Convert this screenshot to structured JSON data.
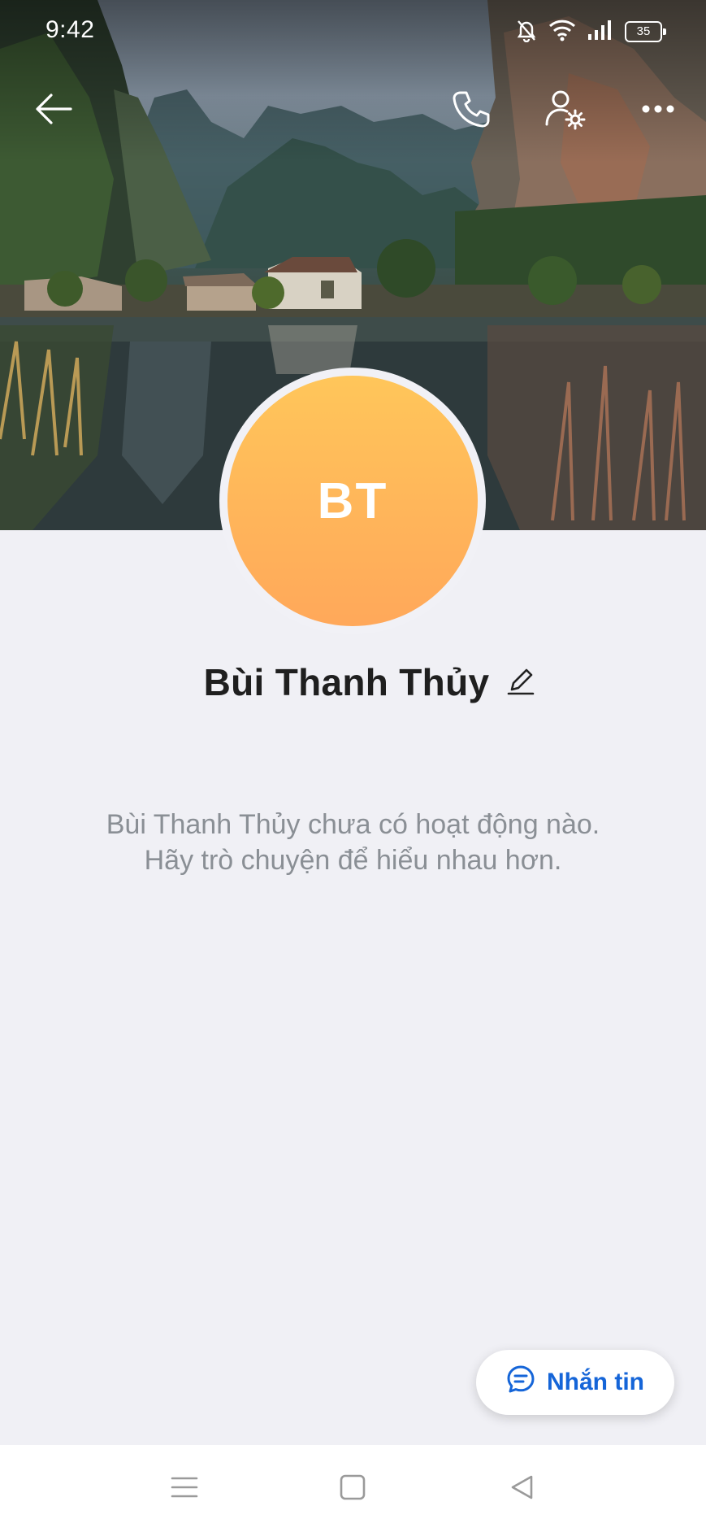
{
  "status_bar": {
    "time": "9:42",
    "battery_level": "35",
    "icons": [
      "mute-bell-icon",
      "wifi-icon",
      "signal-icon",
      "battery-icon"
    ]
  },
  "top_bar": {
    "icons": [
      "back-arrow-icon",
      "phone-icon",
      "user-settings-icon",
      "more-icon"
    ]
  },
  "profile": {
    "initials": "BT",
    "name": "Bùi Thanh Thủy",
    "edit_icon": "pencil-icon",
    "avatar_gradient": [
      "#ffc65a",
      "#ffa85a"
    ]
  },
  "timeline": {
    "empty_line1": "Bùi Thanh Thủy chưa có hoạt động nào.",
    "empty_line2": "Hãy trò chuyện để hiểu nhau hơn."
  },
  "message_button": {
    "label": "Nhắn tin",
    "icon": "chat-bubble-icon",
    "color": "#1565d8"
  },
  "nav_bar": {
    "icons": [
      "menu-icon",
      "home-icon",
      "back-icon"
    ]
  }
}
